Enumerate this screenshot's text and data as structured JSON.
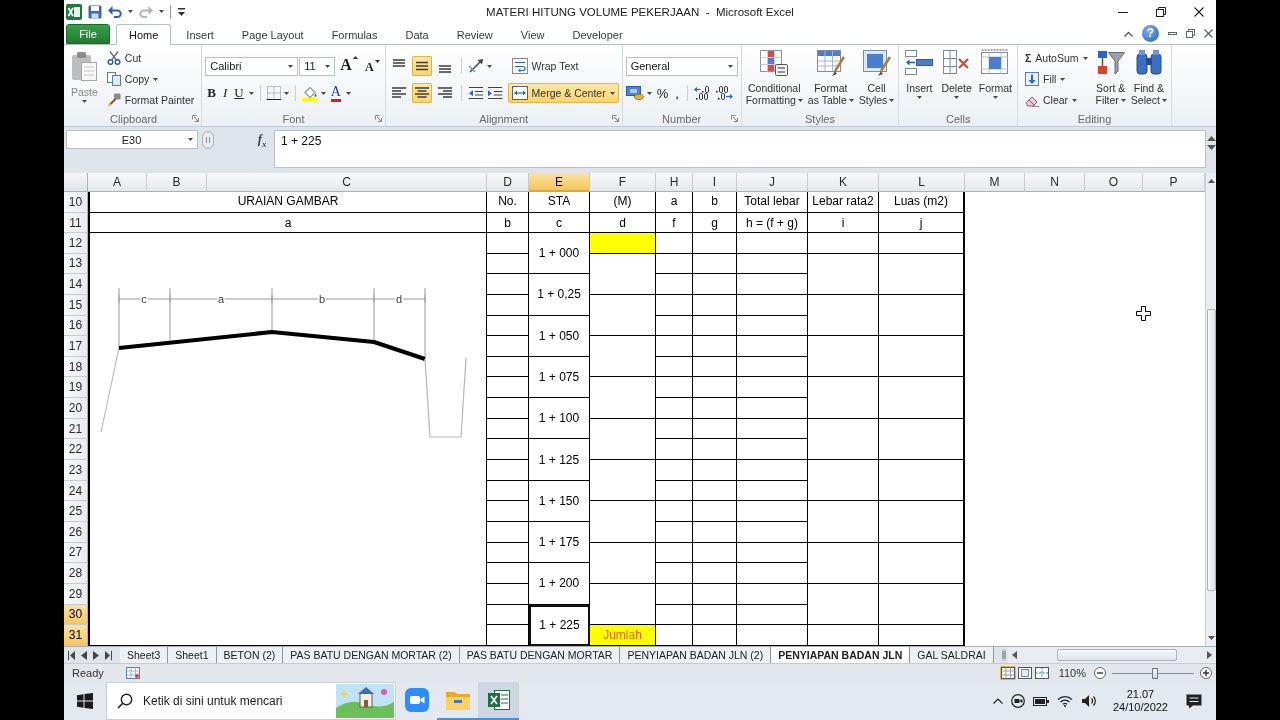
{
  "window": {
    "title": "MATERI HITUNG VOLUME PEKERJAAN  -  Microsoft Excel"
  },
  "quick_access": {
    "undo_disabled": false,
    "redo_disabled": true
  },
  "ribbon_tabs": [
    {
      "label": "File",
      "kind": "file",
      "selected": false
    },
    {
      "label": "Home",
      "kind": "tab",
      "selected": true
    },
    {
      "label": "Insert",
      "kind": "tab",
      "selected": false
    },
    {
      "label": "Page Layout",
      "kind": "tab",
      "selected": false
    },
    {
      "label": "Formulas",
      "kind": "tab",
      "selected": false
    },
    {
      "label": "Data",
      "kind": "tab",
      "selected": false
    },
    {
      "label": "Review",
      "kind": "tab",
      "selected": false
    },
    {
      "label": "View",
      "kind": "tab",
      "selected": false
    },
    {
      "label": "Developer",
      "kind": "tab",
      "selected": false
    }
  ],
  "help": {
    "label": "?"
  },
  "clipboard": {
    "label": "Clipboard",
    "paste": {
      "label": "Paste",
      "disabled": true
    },
    "cut": "Cut",
    "copy": "Copy",
    "format_painter": "Format Painter"
  },
  "font": {
    "label": "Font",
    "name": "Calibri",
    "size": "11",
    "grow": "A",
    "shrink": "A",
    "bold": "B",
    "italic": "I",
    "underline": "U",
    "tint_letter": "A"
  },
  "alignment": {
    "label": "Alignment",
    "vertical": [
      {
        "kind": "top",
        "selected": false
      },
      {
        "kind": "middle",
        "selected": true
      },
      {
        "kind": "bottom",
        "selected": false
      }
    ],
    "horizontal": [
      {
        "kind": "left",
        "selected": false
      },
      {
        "kind": "center",
        "selected": true
      },
      {
        "kind": "right",
        "selected": false
      }
    ],
    "wrap_text": {
      "label": "Wrap Text",
      "selected": false
    },
    "merge_center": {
      "label": "Merge & Center",
      "selected": true
    }
  },
  "number": {
    "label": "Number",
    "format": "General",
    "percent": "%",
    "comma": ","
  },
  "styles": {
    "label": "Styles",
    "buttons": [
      {
        "kind": "conditional",
        "lines": [
          "Conditional",
          "Formatting"
        ]
      },
      {
        "kind": "table",
        "lines": [
          "Format",
          "as Table"
        ]
      },
      {
        "kind": "cell",
        "lines": [
          "Cell",
          "Styles"
        ]
      }
    ]
  },
  "cells": {
    "label": "Cells",
    "buttons": [
      {
        "kind": "insert",
        "label": "Insert"
      },
      {
        "kind": "delete",
        "label": "Delete"
      },
      {
        "kind": "format",
        "label": "Format"
      }
    ]
  },
  "editing": {
    "label": "Editing",
    "autosum_symbol": "Σ",
    "autosum": "AutoSum",
    "fill": "Fill",
    "clear": "Clear",
    "buttons": [
      {
        "kind": "sort",
        "lines": [
          "Sort &",
          "Filter"
        ]
      },
      {
        "kind": "find",
        "lines": [
          "Find &",
          "Select"
        ]
      }
    ]
  },
  "formula_bar": {
    "name_box": "E30",
    "function_label": "f$_{x}$",
    "formula": "1 + 225"
  },
  "sheet": {
    "columns": [
      {
        "label": "A",
        "selected": false
      },
      {
        "label": "B",
        "selected": false
      },
      {
        "label": "C",
        "selected": false
      },
      {
        "label": "D",
        "selected": false
      },
      {
        "label": "E",
        "selected": true
      },
      {
        "label": "F",
        "selected": false
      },
      {
        "label": "H",
        "selected": false
      },
      {
        "label": "I",
        "selected": false
      },
      {
        "label": "J",
        "selected": false
      },
      {
        "label": "K",
        "selected": false
      },
      {
        "label": "L",
        "selected": false
      },
      {
        "label": "M",
        "selected": false
      },
      {
        "label": "N",
        "selected": false
      },
      {
        "label": "O",
        "selected": false
      },
      {
        "label": "P",
        "selected": false
      }
    ],
    "rows": [
      {
        "label": "10",
        "selected": false
      },
      {
        "label": "11",
        "selected": false
      },
      {
        "label": "12",
        "selected": false
      },
      {
        "label": "13",
        "selected": false
      },
      {
        "label": "14",
        "selected": false
      },
      {
        "label": "15",
        "selected": false
      },
      {
        "label": "16",
        "selected": false
      },
      {
        "label": "17",
        "selected": false
      },
      {
        "label": "18",
        "selected": false
      },
      {
        "label": "19",
        "selected": false
      },
      {
        "label": "20",
        "selected": false
      },
      {
        "label": "21",
        "selected": false
      },
      {
        "label": "22",
        "selected": false
      },
      {
        "label": "23",
        "selected": false
      },
      {
        "label": "24",
        "selected": false
      },
      {
        "label": "25",
        "selected": false
      },
      {
        "label": "26",
        "selected": false
      },
      {
        "label": "27",
        "selected": false
      },
      {
        "label": "28",
        "selected": false
      },
      {
        "label": "29",
        "selected": false
      },
      {
        "label": "30",
        "selected": true
      },
      {
        "label": "31",
        "selected": true
      }
    ],
    "header_row": [
      "URAIAN GAMBAR",
      "No.",
      "STA",
      "(M)",
      "a",
      "b",
      "Total lebar",
      "Lebar rata2",
      "Luas (m2)"
    ],
    "letter_row": [
      "a",
      "b",
      "c",
      "d",
      "f",
      "g",
      "h = (f + g)",
      "i",
      "j"
    ],
    "drawing": {
      "labels": [
        "c",
        "a",
        "b",
        "d"
      ]
    },
    "stations": [
      {
        "text": "1 + 000",
        "selected": false
      },
      {
        "text": "1 + 0,25",
        "selected": false
      },
      {
        "text": "1 + 050",
        "selected": false
      },
      {
        "text": "1 + 075",
        "selected": false
      },
      {
        "text": "1 + 100",
        "selected": false
      },
      {
        "text": "1 + 125",
        "selected": false
      },
      {
        "text": "1 + 150",
        "selected": false
      },
      {
        "text": "1 + 175",
        "selected": false
      },
      {
        "text": "1 + 200",
        "selected": false
      },
      {
        "text": "1 + 225",
        "selected": true
      }
    ],
    "total_label": "Jumlah"
  },
  "sheet_tabs": [
    {
      "label": "Sheet3",
      "selected": false
    },
    {
      "label": "Sheet1",
      "selected": false
    },
    {
      "label": "BETON (2)",
      "selected": false
    },
    {
      "label": "PAS BATU DENGAN MORTAR (2)",
      "selected": false
    },
    {
      "label": "PAS BATU DENGAN MORTAR",
      "selected": false
    },
    {
      "label": "PENYIAPAN BADAN JLN (2)",
      "selected": false
    },
    {
      "label": "PENYIAPAN BADAN JLN",
      "selected": true
    },
    {
      "label": "GAL SALDRAI",
      "selected": false
    }
  ],
  "status_bar": {
    "mode": "Ready",
    "views": [
      {
        "kind": "normal",
        "selected": true
      },
      {
        "kind": "page_layout",
        "selected": false
      },
      {
        "kind": "page_break",
        "selected": false
      }
    ],
    "zoom": {
      "label": "110%",
      "level": 0.52
    }
  },
  "taskbar": {
    "search": {
      "placeholder": "Ketik di sini untuk mencari"
    },
    "apps": [
      {
        "kind": "video",
        "running": false,
        "selected": false
      },
      {
        "kind": "folder",
        "running": true,
        "selected": false
      },
      {
        "kind": "spreadsheet",
        "running": true,
        "selected": true
      }
    ],
    "time": "21.07",
    "date": "24/10/2022"
  }
}
